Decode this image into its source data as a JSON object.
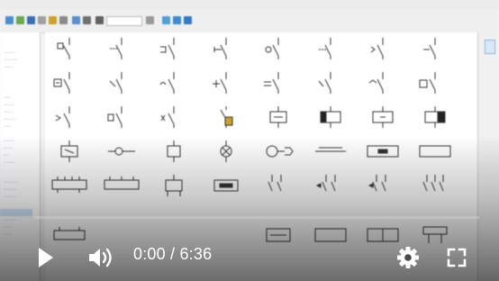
{
  "player": {
    "current_time": "0:00",
    "separator": " / ",
    "duration": "6:36",
    "progress_fraction": 0.0
  },
  "icons": {
    "play": "play-icon",
    "volume": "volume-icon",
    "settings": "gear-icon",
    "fullscreen": "fullscreen-icon"
  },
  "colors": {
    "progress_played": "#ff0000",
    "controls": "#ffffff",
    "symbol_label": "#5a70a8"
  }
}
